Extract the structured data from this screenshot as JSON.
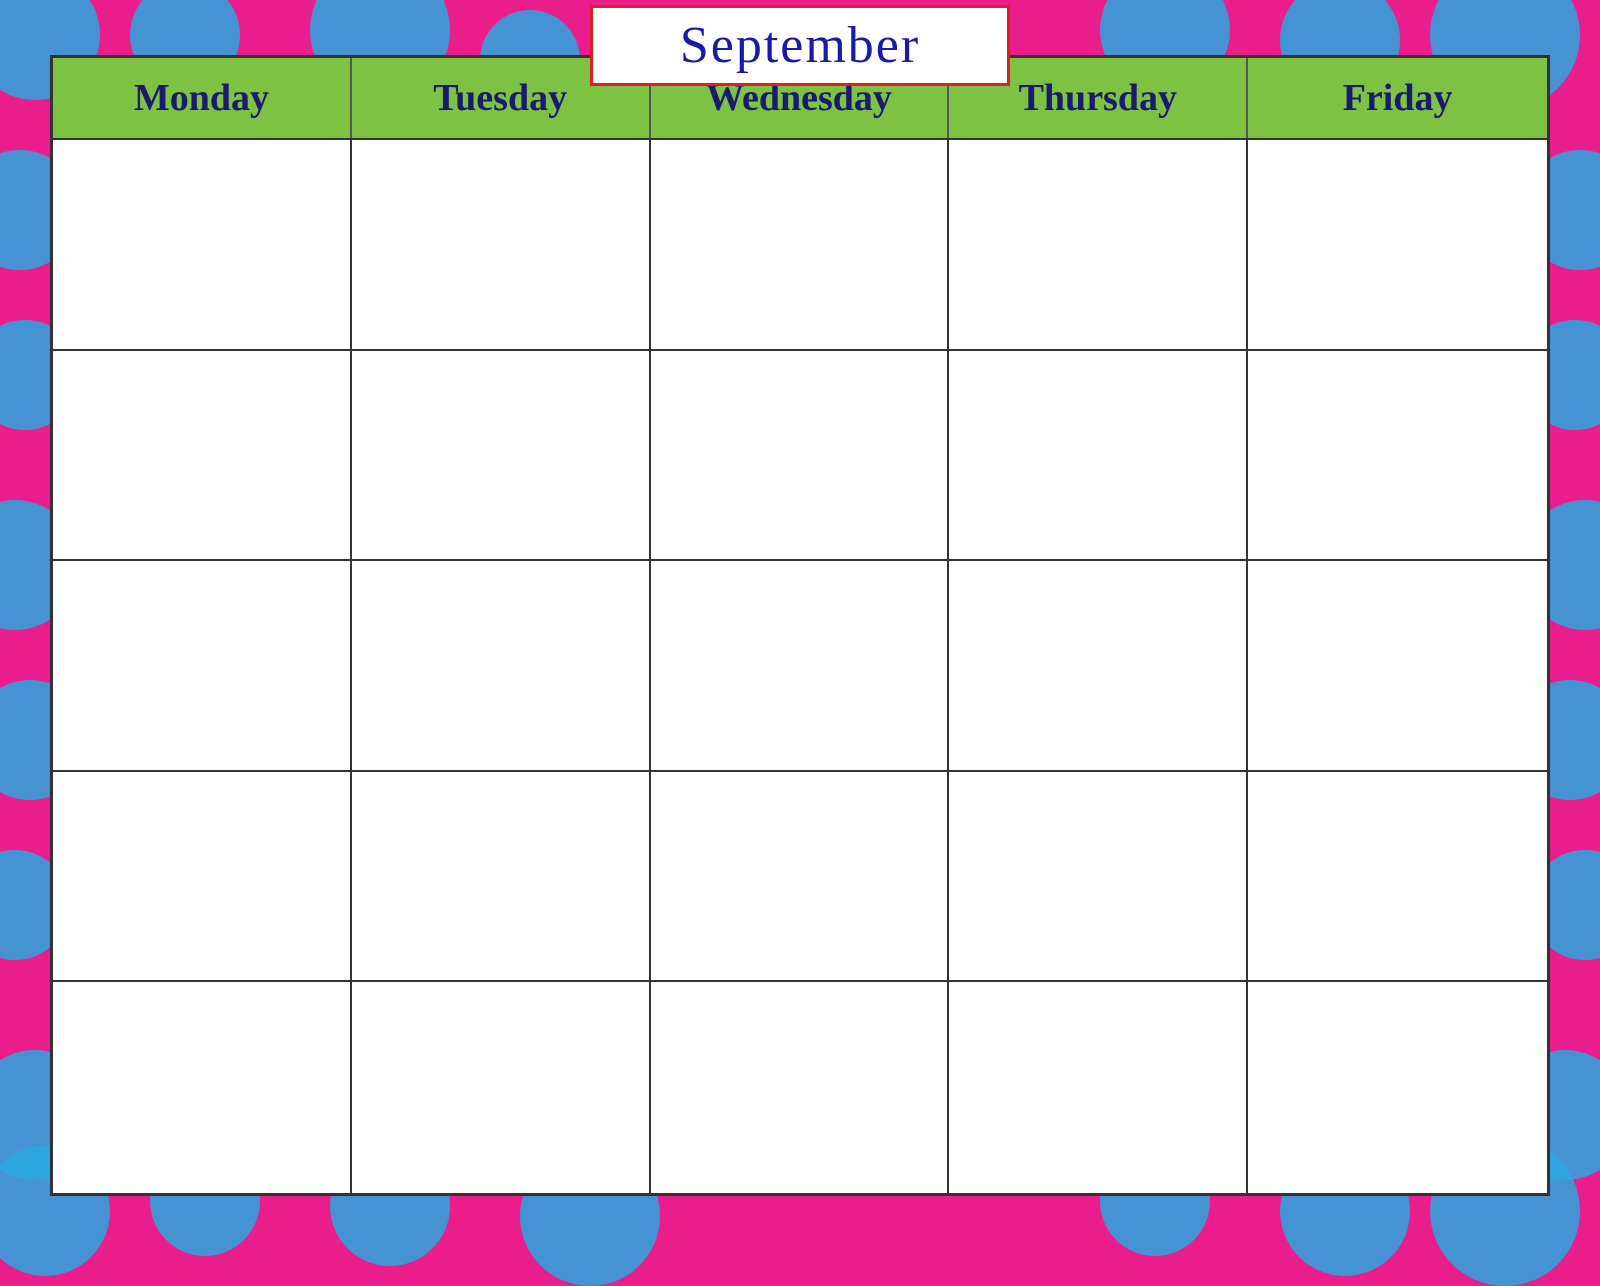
{
  "background": {
    "color": "#e91e8c",
    "dot_color": "#29a8e0"
  },
  "calendar": {
    "month": "September",
    "days": [
      "Monday",
      "Tuesday",
      "Wednesday",
      "Thursday",
      "Friday"
    ],
    "rows": 5,
    "header_bg": "#7dc242",
    "border_color": "#e02020"
  }
}
